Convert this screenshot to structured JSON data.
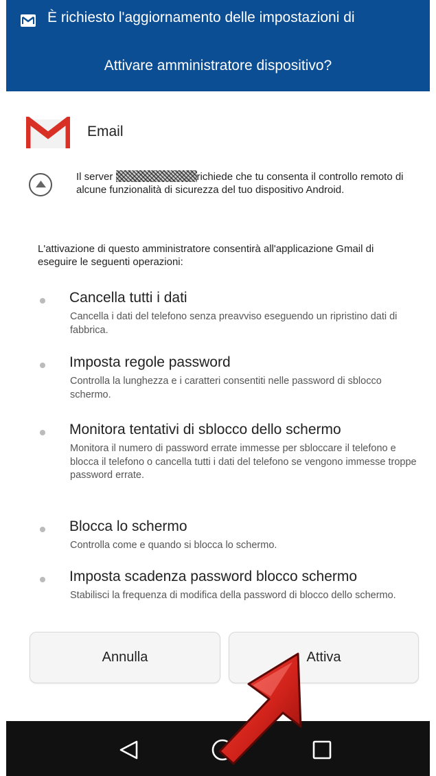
{
  "notification": {
    "line1": "È richiesto l'aggiornamento delle impostazioni di",
    "line2": "Attivare amministratore dispositivo?",
    "icon": "mail-icon",
    "background": "#0c4e93"
  },
  "app": {
    "icon": "gmail-logo",
    "name": "Email"
  },
  "server_notice": {
    "prefix": "Il server",
    "suffix": "richiede che tu consenta il controllo remoto di alcune funzionalità di sicurezza del tuo dispositivo Android."
  },
  "intro": "L'attivazione di questo amministratore consentirà all'applicazione Gmail di eseguire le seguenti operazioni:",
  "permissions": [
    {
      "title": "Cancella tutti i dati",
      "desc": "Cancella i dati del telefono senza preavviso eseguendo un ripristino dati di fabbrica."
    },
    {
      "title": "Imposta regole password",
      "desc": "Controlla la lunghezza e i caratteri consentiti nelle password di sblocco schermo."
    },
    {
      "title": "Monitora tentativi di sblocco dello schermo",
      "desc": "Monitora il numero di password errate immesse per sbloccare il telefono e blocca il telefono o cancella tutti i dati del telefono se vengono immesse troppe password errate."
    },
    {
      "title": "Blocca lo schermo",
      "desc": "Controlla come e quando si blocca lo schermo."
    },
    {
      "title": "Imposta scadenza password blocco schermo",
      "desc": "Stabilisci la frequenza di modifica della password di blocco dello schermo."
    }
  ],
  "buttons": {
    "cancel": "Annulla",
    "activate": "Attiva"
  },
  "navigation": {
    "back": "back-icon",
    "home": "home-icon",
    "recents": "recents-icon"
  },
  "colors": {
    "header": "#0c4e93",
    "arrow": "#d2231b",
    "navbar": "#111111"
  }
}
